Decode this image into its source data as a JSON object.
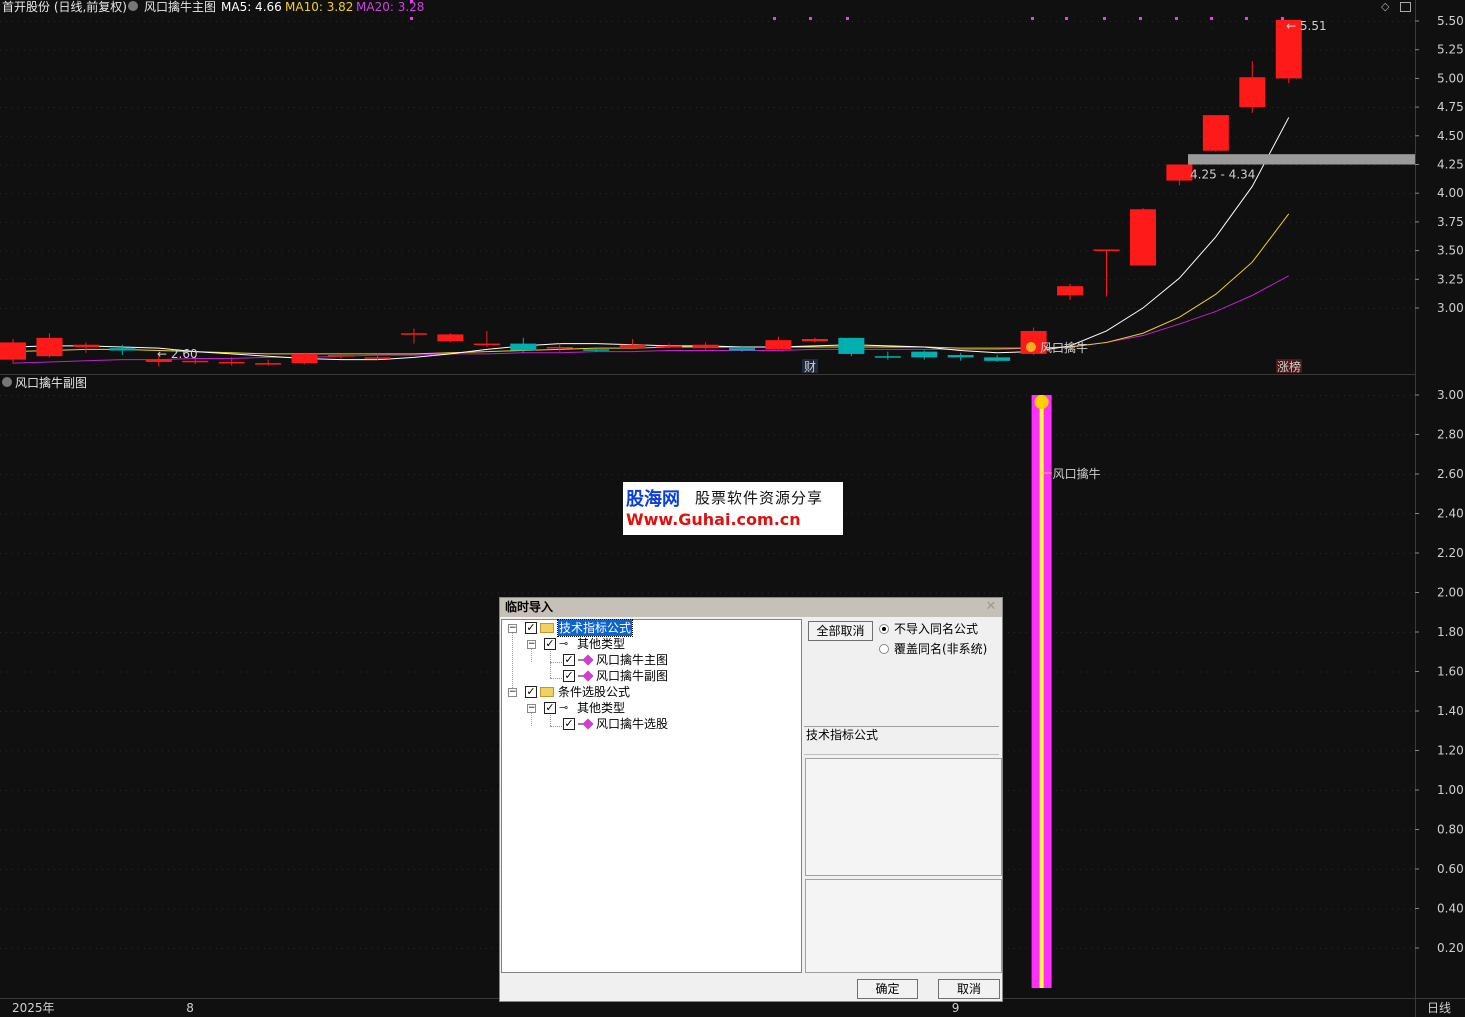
{
  "header": {
    "stock": "首开股份 (日线,前复权)",
    "indicator_name": "风口擒牛主图",
    "ma5_label": "MA5: 4.66",
    "ma10_label": "MA10: 3.82",
    "ma20_label": "MA20: 3.28",
    "sub_indicator_name": "风口擒牛副图"
  },
  "colors": {
    "background": "#101010",
    "up": "#ff1a1a",
    "down": "#00b0b0",
    "ma5": "#ffffff",
    "ma10": "#f0d020",
    "ma20": "#c020d0",
    "signal": "#ff30ff"
  },
  "chart_data": [
    {
      "type": "candlestick",
      "title": "风口擒牛主图",
      "ylim": [
        2.3,
        5.65
      ],
      "y_ticks": [
        "5.50",
        "5.25",
        "5.00",
        "4.75",
        "4.50",
        "4.25",
        "4.00",
        "3.75",
        "3.50",
        "3.25",
        "3.00"
      ],
      "candles": [
        {
          "o": 2.55,
          "h": 2.73,
          "l": 2.52,
          "c": 2.7
        },
        {
          "o": 2.58,
          "h": 2.78,
          "l": 2.57,
          "c": 2.74
        },
        {
          "o": 2.66,
          "h": 2.7,
          "l": 2.61,
          "c": 2.68
        },
        {
          "o": 2.65,
          "h": 2.68,
          "l": 2.59,
          "c": 2.63
        },
        {
          "o": 2.53,
          "h": 2.58,
          "l": 2.49,
          "c": 2.55
        },
        {
          "o": 2.54,
          "h": 2.58,
          "l": 2.51,
          "c": 2.54
        },
        {
          "o": 2.53,
          "h": 2.57,
          "l": 2.5,
          "c": 2.53
        },
        {
          "o": 2.51,
          "h": 2.55,
          "l": 2.5,
          "c": 2.52
        },
        {
          "o": 2.52,
          "h": 2.61,
          "l": 2.51,
          "c": 2.6
        },
        {
          "o": 2.58,
          "h": 2.6,
          "l": 2.56,
          "c": 2.59
        },
        {
          "o": 2.57,
          "h": 2.6,
          "l": 2.55,
          "c": 2.57
        },
        {
          "o": 2.77,
          "h": 2.82,
          "l": 2.69,
          "c": 2.78
        },
        {
          "o": 2.71,
          "h": 2.78,
          "l": 2.7,
          "c": 2.77
        },
        {
          "o": 2.68,
          "h": 2.8,
          "l": 2.66,
          "c": 2.69
        },
        {
          "o": 2.69,
          "h": 2.74,
          "l": 2.61,
          "c": 2.63
        },
        {
          "o": 2.66,
          "h": 2.69,
          "l": 2.62,
          "c": 2.66
        },
        {
          "o": 2.64,
          "h": 2.65,
          "l": 2.62,
          "c": 2.63
        },
        {
          "o": 2.65,
          "h": 2.73,
          "l": 2.64,
          "c": 2.68
        },
        {
          "o": 2.66,
          "h": 2.69,
          "l": 2.65,
          "c": 2.67
        },
        {
          "o": 2.65,
          "h": 2.7,
          "l": 2.64,
          "c": 2.68
        },
        {
          "o": 2.65,
          "h": 2.67,
          "l": 2.62,
          "c": 2.63
        },
        {
          "o": 2.64,
          "h": 2.75,
          "l": 2.63,
          "c": 2.72
        },
        {
          "o": 2.71,
          "h": 2.74,
          "l": 2.7,
          "c": 2.73
        },
        {
          "o": 2.74,
          "h": 2.74,
          "l": 2.58,
          "c": 2.6
        },
        {
          "o": 2.58,
          "h": 2.62,
          "l": 2.55,
          "c": 2.57
        },
        {
          "o": 2.62,
          "h": 2.63,
          "l": 2.55,
          "c": 2.57
        },
        {
          "o": 2.59,
          "h": 2.61,
          "l": 2.54,
          "c": 2.57
        },
        {
          "o": 2.57,
          "h": 2.59,
          "l": 2.53,
          "c": 2.54
        },
        {
          "o": 2.6,
          "h": 2.83,
          "l": 2.59,
          "c": 2.8
        },
        {
          "o": 3.11,
          "h": 3.21,
          "l": 3.07,
          "c": 3.19
        },
        {
          "o": 3.5,
          "h": 3.51,
          "l": 3.1,
          "c": 3.51
        },
        {
          "o": 3.37,
          "h": 3.87,
          "l": 3.37,
          "c": 3.86
        },
        {
          "o": 4.11,
          "h": 4.25,
          "l": 4.07,
          "c": 4.25
        },
        {
          "o": 4.37,
          "h": 4.68,
          "l": 4.36,
          "c": 4.68
        },
        {
          "o": 4.75,
          "h": 5.15,
          "l": 4.7,
          "c": 5.01
        },
        {
          "o": 5.0,
          "h": 5.51,
          "l": 4.96,
          "c": 5.51
        }
      ],
      "ma5": [
        2.66,
        2.67,
        2.67,
        2.66,
        2.65,
        2.62,
        2.6,
        2.58,
        2.56,
        2.55,
        2.55,
        2.57,
        2.6,
        2.64,
        2.67,
        2.69,
        2.69,
        2.68,
        2.67,
        2.67,
        2.66,
        2.66,
        2.67,
        2.68,
        2.67,
        2.66,
        2.63,
        2.61,
        2.62,
        2.67,
        2.8,
        3.0,
        3.26,
        3.62,
        4.06,
        4.66
      ],
      "ma10": [
        2.62,
        2.63,
        2.64,
        2.64,
        2.63,
        2.62,
        2.61,
        2.6,
        2.6,
        2.6,
        2.6,
        2.6,
        2.61,
        2.62,
        2.63,
        2.64,
        2.65,
        2.65,
        2.66,
        2.66,
        2.66,
        2.66,
        2.66,
        2.66,
        2.66,
        2.66,
        2.65,
        2.65,
        2.65,
        2.66,
        2.7,
        2.78,
        2.92,
        3.12,
        3.4,
        3.82
      ],
      "ma20": [
        2.52,
        2.53,
        2.54,
        2.55,
        2.55,
        2.56,
        2.56,
        2.57,
        2.57,
        2.58,
        2.59,
        2.59,
        2.6,
        2.6,
        2.61,
        2.61,
        2.62,
        2.62,
        2.63,
        2.63,
        2.63,
        2.63,
        2.64,
        2.64,
        2.64,
        2.64,
        2.64,
        2.64,
        2.65,
        2.66,
        2.7,
        2.76,
        2.86,
        2.97,
        3.11,
        3.28
      ],
      "annotations": {
        "low_label": "2.60",
        "high_label": "5.51",
        "range_label": "4.25 - 4.34",
        "range_low": 4.25,
        "range_high": 4.34,
        "signal_label": "风口擒牛",
        "finance_label": "财",
        "limit_label": "涨榜"
      }
    },
    {
      "type": "bar",
      "title": "风口擒牛副图",
      "ylim": [
        0,
        3.0
      ],
      "y_ticks": [
        "3.00",
        "2.80",
        "2.60",
        "2.40",
        "2.20",
        "2.00",
        "1.80",
        "1.60",
        "1.40",
        "1.20",
        "1.00",
        "0.80",
        "0.60",
        "0.40",
        "0.20"
      ],
      "signal_bar_index": 28,
      "signal_value": 3.0,
      "signal_label": "风口擒牛"
    }
  ],
  "xaxis": {
    "labels": [
      {
        "text": "2025年",
        "index": 0
      },
      {
        "text": "8",
        "index": 5
      },
      {
        "text": "9",
        "index": 26
      }
    ],
    "period": "日线"
  },
  "watermark": {
    "brand": "股海网",
    "slogan": "股票软件资源分享",
    "url": "Www.Guhai.com.cn"
  },
  "dialog": {
    "title": "临时导入",
    "tree": [
      {
        "label": "技术指标公式",
        "level": 0,
        "icon": "folder"
      },
      {
        "label": "其他类型",
        "level": 1,
        "icon": "key"
      },
      {
        "label": "风口擒牛主图",
        "level": 2,
        "icon": "gem"
      },
      {
        "label": "风口擒牛副图",
        "level": 2,
        "icon": "gem"
      },
      {
        "label": "条件选股公式",
        "level": 0,
        "icon": "folder"
      },
      {
        "label": "其他类型",
        "level": 1,
        "icon": "key"
      },
      {
        "label": "风口擒牛选股",
        "level": 2,
        "icon": "gem"
      }
    ],
    "cancel_all": "全部取消",
    "radio_skip": "不导入同名公式",
    "radio_overwrite": "覆盖同名(非系统)",
    "selected_type": "技术指标公式",
    "ok": "确定",
    "cancel": "取消"
  }
}
